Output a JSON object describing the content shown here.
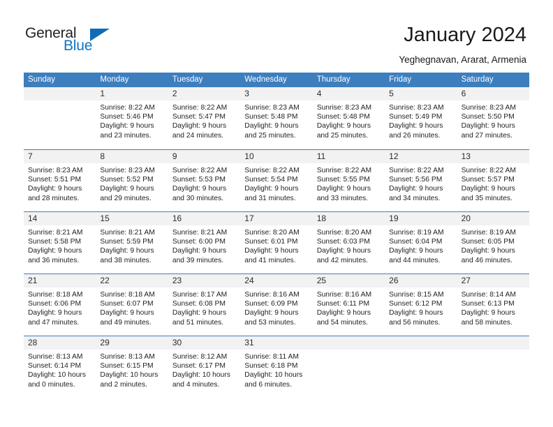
{
  "brand": {
    "name_part1": "General",
    "name_part2": "Blue",
    "accent_color": "#0f6cb5"
  },
  "header": {
    "title": "January 2024",
    "subtitle": "Yeghegnavan, Ararat, Armenia",
    "header_bg_color": "#3d7ebf",
    "daynum_band_color": "#f2f2f2"
  },
  "weekdays": [
    "Sunday",
    "Monday",
    "Tuesday",
    "Wednesday",
    "Thursday",
    "Friday",
    "Saturday"
  ],
  "calendar": {
    "month": "January",
    "year": "2024",
    "weeks": [
      [
        {
          "day": "",
          "lines": []
        },
        {
          "day": "1",
          "lines": [
            "Sunrise: 8:22 AM",
            "Sunset: 5:46 PM",
            "Daylight: 9 hours",
            "and 23 minutes."
          ]
        },
        {
          "day": "2",
          "lines": [
            "Sunrise: 8:22 AM",
            "Sunset: 5:47 PM",
            "Daylight: 9 hours",
            "and 24 minutes."
          ]
        },
        {
          "day": "3",
          "lines": [
            "Sunrise: 8:23 AM",
            "Sunset: 5:48 PM",
            "Daylight: 9 hours",
            "and 25 minutes."
          ]
        },
        {
          "day": "4",
          "lines": [
            "Sunrise: 8:23 AM",
            "Sunset: 5:48 PM",
            "Daylight: 9 hours",
            "and 25 minutes."
          ]
        },
        {
          "day": "5",
          "lines": [
            "Sunrise: 8:23 AM",
            "Sunset: 5:49 PM",
            "Daylight: 9 hours",
            "and 26 minutes."
          ]
        },
        {
          "day": "6",
          "lines": [
            "Sunrise: 8:23 AM",
            "Sunset: 5:50 PM",
            "Daylight: 9 hours",
            "and 27 minutes."
          ]
        }
      ],
      [
        {
          "day": "7",
          "lines": [
            "Sunrise: 8:23 AM",
            "Sunset: 5:51 PM",
            "Daylight: 9 hours",
            "and 28 minutes."
          ]
        },
        {
          "day": "8",
          "lines": [
            "Sunrise: 8:23 AM",
            "Sunset: 5:52 PM",
            "Daylight: 9 hours",
            "and 29 minutes."
          ]
        },
        {
          "day": "9",
          "lines": [
            "Sunrise: 8:22 AM",
            "Sunset: 5:53 PM",
            "Daylight: 9 hours",
            "and 30 minutes."
          ]
        },
        {
          "day": "10",
          "lines": [
            "Sunrise: 8:22 AM",
            "Sunset: 5:54 PM",
            "Daylight: 9 hours",
            "and 31 minutes."
          ]
        },
        {
          "day": "11",
          "lines": [
            "Sunrise: 8:22 AM",
            "Sunset: 5:55 PM",
            "Daylight: 9 hours",
            "and 33 minutes."
          ]
        },
        {
          "day": "12",
          "lines": [
            "Sunrise: 8:22 AM",
            "Sunset: 5:56 PM",
            "Daylight: 9 hours",
            "and 34 minutes."
          ]
        },
        {
          "day": "13",
          "lines": [
            "Sunrise: 8:22 AM",
            "Sunset: 5:57 PM",
            "Daylight: 9 hours",
            "and 35 minutes."
          ]
        }
      ],
      [
        {
          "day": "14",
          "lines": [
            "Sunrise: 8:21 AM",
            "Sunset: 5:58 PM",
            "Daylight: 9 hours",
            "and 36 minutes."
          ]
        },
        {
          "day": "15",
          "lines": [
            "Sunrise: 8:21 AM",
            "Sunset: 5:59 PM",
            "Daylight: 9 hours",
            "and 38 minutes."
          ]
        },
        {
          "day": "16",
          "lines": [
            "Sunrise: 8:21 AM",
            "Sunset: 6:00 PM",
            "Daylight: 9 hours",
            "and 39 minutes."
          ]
        },
        {
          "day": "17",
          "lines": [
            "Sunrise: 8:20 AM",
            "Sunset: 6:01 PM",
            "Daylight: 9 hours",
            "and 41 minutes."
          ]
        },
        {
          "day": "18",
          "lines": [
            "Sunrise: 8:20 AM",
            "Sunset: 6:03 PM",
            "Daylight: 9 hours",
            "and 42 minutes."
          ]
        },
        {
          "day": "19",
          "lines": [
            "Sunrise: 8:19 AM",
            "Sunset: 6:04 PM",
            "Daylight: 9 hours",
            "and 44 minutes."
          ]
        },
        {
          "day": "20",
          "lines": [
            "Sunrise: 8:19 AM",
            "Sunset: 6:05 PM",
            "Daylight: 9 hours",
            "and 46 minutes."
          ]
        }
      ],
      [
        {
          "day": "21",
          "lines": [
            "Sunrise: 8:18 AM",
            "Sunset: 6:06 PM",
            "Daylight: 9 hours",
            "and 47 minutes."
          ]
        },
        {
          "day": "22",
          "lines": [
            "Sunrise: 8:18 AM",
            "Sunset: 6:07 PM",
            "Daylight: 9 hours",
            "and 49 minutes."
          ]
        },
        {
          "day": "23",
          "lines": [
            "Sunrise: 8:17 AM",
            "Sunset: 6:08 PM",
            "Daylight: 9 hours",
            "and 51 minutes."
          ]
        },
        {
          "day": "24",
          "lines": [
            "Sunrise: 8:16 AM",
            "Sunset: 6:09 PM",
            "Daylight: 9 hours",
            "and 53 minutes."
          ]
        },
        {
          "day": "25",
          "lines": [
            "Sunrise: 8:16 AM",
            "Sunset: 6:11 PM",
            "Daylight: 9 hours",
            "and 54 minutes."
          ]
        },
        {
          "day": "26",
          "lines": [
            "Sunrise: 8:15 AM",
            "Sunset: 6:12 PM",
            "Daylight: 9 hours",
            "and 56 minutes."
          ]
        },
        {
          "day": "27",
          "lines": [
            "Sunrise: 8:14 AM",
            "Sunset: 6:13 PM",
            "Daylight: 9 hours",
            "and 58 minutes."
          ]
        }
      ],
      [
        {
          "day": "28",
          "lines": [
            "Sunrise: 8:13 AM",
            "Sunset: 6:14 PM",
            "Daylight: 10 hours",
            "and 0 minutes."
          ]
        },
        {
          "day": "29",
          "lines": [
            "Sunrise: 8:13 AM",
            "Sunset: 6:15 PM",
            "Daylight: 10 hours",
            "and 2 minutes."
          ]
        },
        {
          "day": "30",
          "lines": [
            "Sunrise: 8:12 AM",
            "Sunset: 6:17 PM",
            "Daylight: 10 hours",
            "and 4 minutes."
          ]
        },
        {
          "day": "31",
          "lines": [
            "Sunrise: 8:11 AM",
            "Sunset: 6:18 PM",
            "Daylight: 10 hours",
            "and 6 minutes."
          ]
        },
        {
          "day": "",
          "lines": []
        },
        {
          "day": "",
          "lines": []
        },
        {
          "day": "",
          "lines": []
        }
      ]
    ]
  }
}
